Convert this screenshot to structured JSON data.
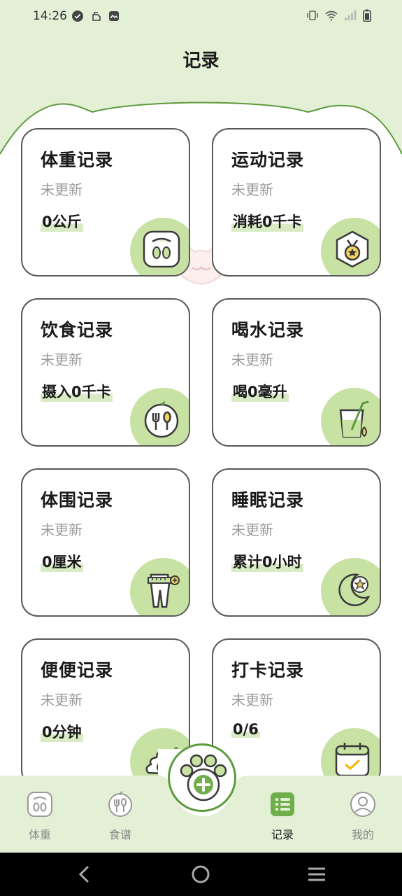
{
  "status_bar": {
    "time": "14:26"
  },
  "page": {
    "title": "记录"
  },
  "cards": [
    {
      "title": "体重记录",
      "status": "未更新",
      "value": "0公斤",
      "icon": "scale-icon"
    },
    {
      "title": "运动记录",
      "status": "未更新",
      "value": "消耗0千卡",
      "icon": "medal-icon"
    },
    {
      "title": "饮食记录",
      "status": "未更新",
      "value": "摄入0千卡",
      "icon": "utensils-icon"
    },
    {
      "title": "喝水记录",
      "status": "未更新",
      "value": "喝0毫升",
      "icon": "drink-cup-icon"
    },
    {
      "title": "体围记录",
      "status": "未更新",
      "value": "0厘米",
      "icon": "measuring-tape-icon"
    },
    {
      "title": "睡眠记录",
      "status": "未更新",
      "value": "累计0小时",
      "icon": "moon-star-icon"
    },
    {
      "title": "便便记录",
      "status": "未更新",
      "value": "0分钟",
      "icon": "poop-icon"
    },
    {
      "title": "打卡记录",
      "status": "未更新",
      "value": "0/6",
      "icon": "calendar-check-icon"
    }
  ],
  "bottom_nav": {
    "items": [
      {
        "label": "体重",
        "icon": "scale-icon"
      },
      {
        "label": "食谱",
        "icon": "utensils-icon"
      },
      {
        "label": "记录",
        "icon": "list-icon",
        "active": true
      },
      {
        "label": "我的",
        "icon": "user-icon"
      }
    ],
    "fab_icon": "paw-plus-icon"
  },
  "colors": {
    "accent": "#5d9a3d",
    "header_bg": "#e3f0d6",
    "icon_bg": "#c8e2a4",
    "highlight": "#d8ebc4"
  }
}
